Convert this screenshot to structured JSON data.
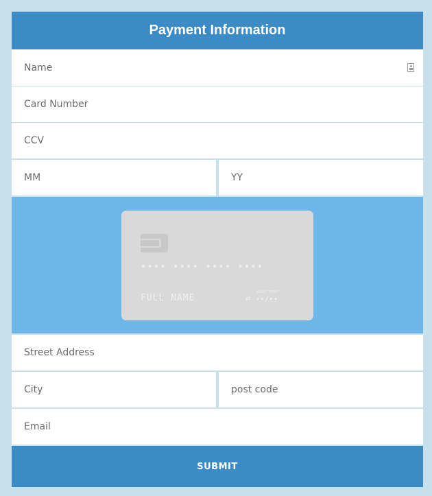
{
  "header": {
    "title": "Payment Information"
  },
  "fields": {
    "name": {
      "placeholder": "Name",
      "icon": "contact-card-icon"
    },
    "card_number": {
      "placeholder": "Card Number"
    },
    "ccv": {
      "placeholder": "CCV"
    },
    "month": {
      "placeholder": "MM"
    },
    "year": {
      "placeholder": "YY"
    },
    "street": {
      "placeholder": "Street Address"
    },
    "city": {
      "placeholder": "City"
    },
    "post_code": {
      "placeholder": "post code"
    },
    "email": {
      "placeholder": "Email"
    }
  },
  "card_preview": {
    "number": "•••• •••• •••• ••••",
    "name": "FULL NAME",
    "valid_label": "VALID THRU",
    "expiry": "••/••",
    "chip_icon": "chip-icon"
  },
  "submit": {
    "label": "SUBMIT"
  },
  "colors": {
    "accent": "#3b8cc6",
    "card_area": "#6eb5e8",
    "background": "#c8dfec",
    "card": "#d9d9d9"
  }
}
